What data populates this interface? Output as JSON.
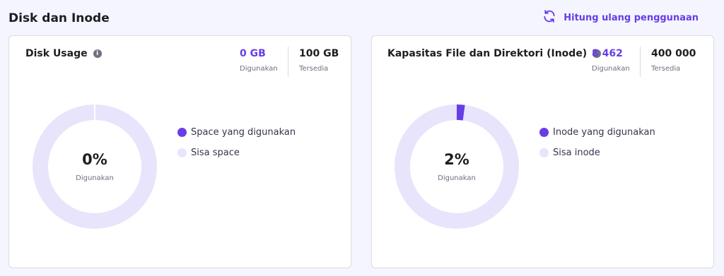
{
  "header": {
    "title": "Disk dan Inode",
    "recalc_label": "Hitung ulang penggunaan",
    "recalc_icon": "refresh-icon"
  },
  "colors": {
    "accent": "#673de6",
    "track": "#e8e4fc",
    "text": "#1d1e20",
    "muted": "#6d7081"
  },
  "disk": {
    "title": "Disk Usage",
    "info_icon": "i",
    "used_value": "0 GB",
    "used_label": "Digunakan",
    "available_value": "100 GB",
    "available_label": "Tersedia",
    "percent_text": "0%",
    "percent_fraction": 0.0,
    "center_label": "Digunakan",
    "legend": [
      "Space yang digunakan",
      "Sisa space"
    ]
  },
  "inode": {
    "title": "Kapasitas File dan Direktori (Inode)",
    "info_icon": "i",
    "used_value": "8 462",
    "used_label": "Digunakan",
    "available_value": "400 000",
    "available_label": "Tersedia",
    "percent_text": "2%",
    "percent_fraction": 0.021,
    "center_label": "Digunakan",
    "legend": [
      "Inode yang digunakan",
      "Sisa inode"
    ]
  }
}
